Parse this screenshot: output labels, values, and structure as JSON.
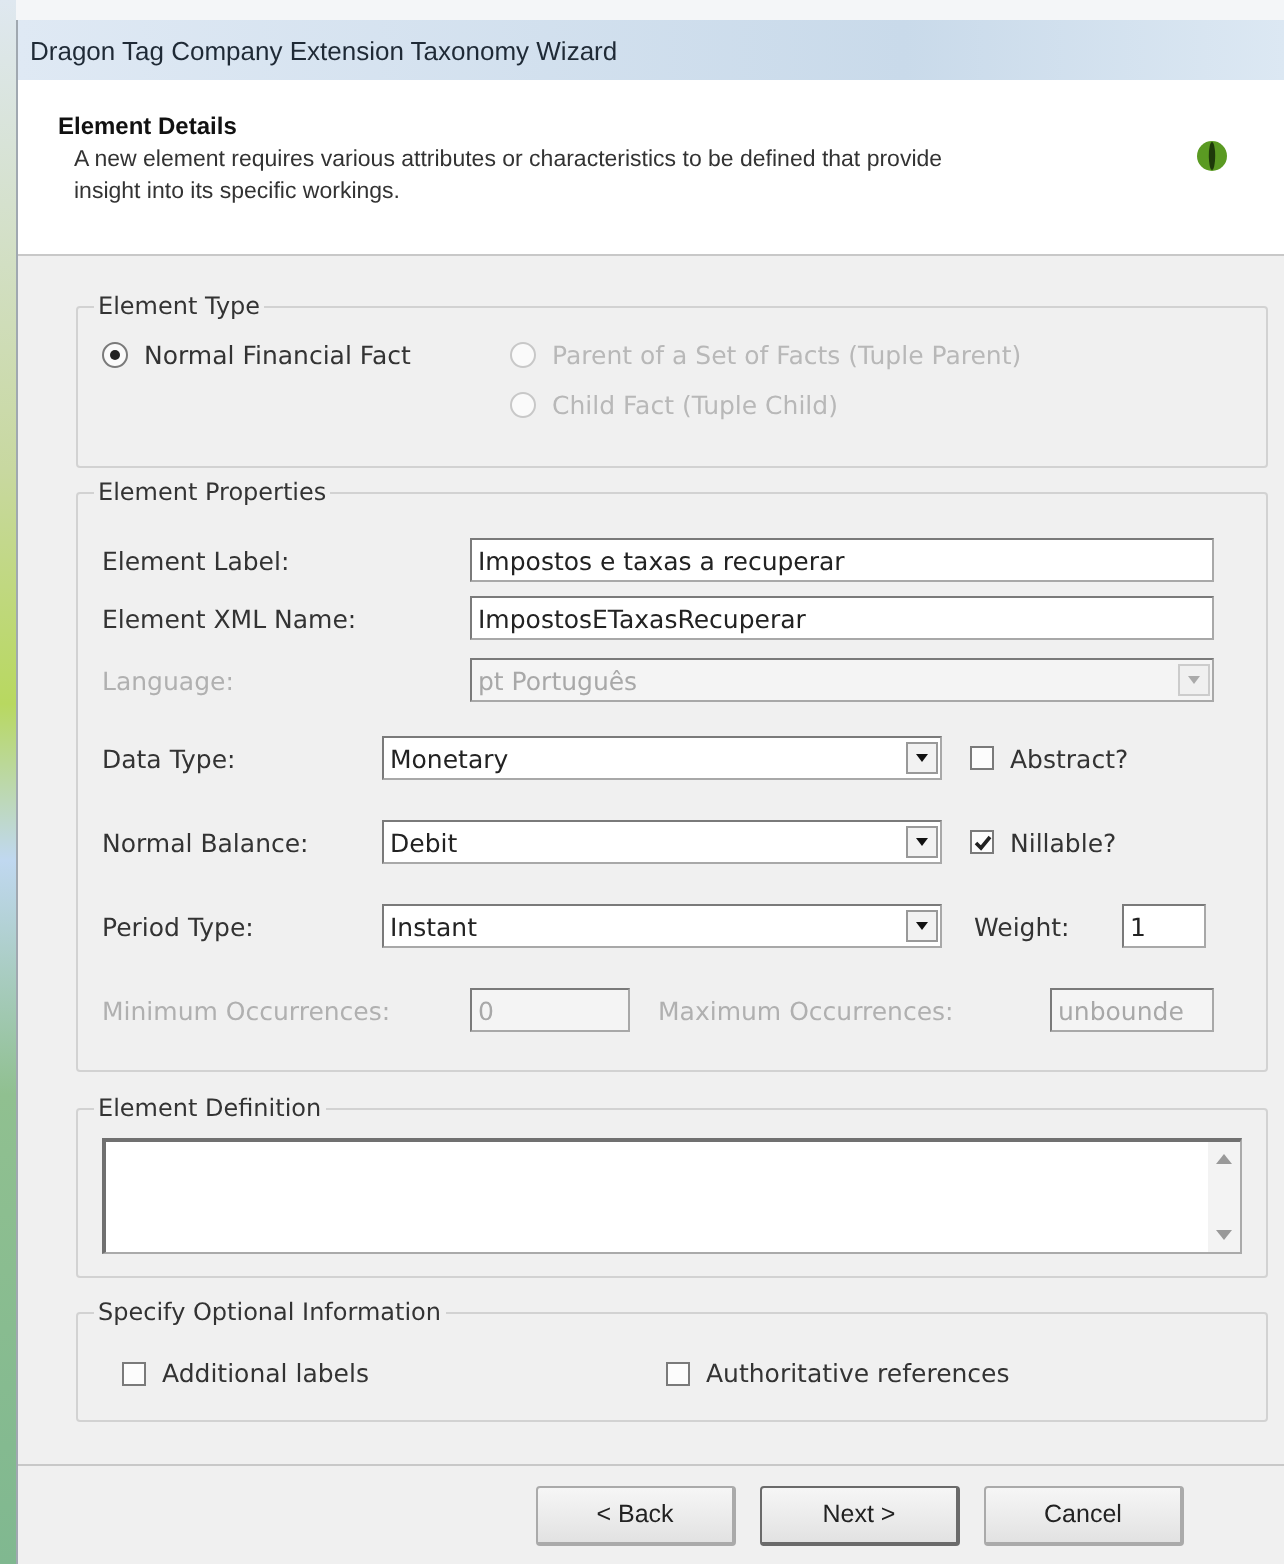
{
  "window": {
    "title": "Dragon Tag Company Extension Taxonomy Wizard"
  },
  "header": {
    "title": "Element Details",
    "description": "A new element requires various attributes or characteristics to be defined that provide insight into its specific workings."
  },
  "element_type": {
    "legend": "Element Type",
    "options": [
      {
        "label": "Normal Financial Fact",
        "selected": true,
        "disabled": false
      },
      {
        "label": "Parent of a Set of Facts (Tuple Parent)",
        "selected": false,
        "disabled": true
      },
      {
        "label": "Child Fact (Tuple Child)",
        "selected": false,
        "disabled": true
      }
    ]
  },
  "element_properties": {
    "legend": "Element Properties",
    "element_label": {
      "label": "Element Label:",
      "value": "Impostos e taxas a recuperar"
    },
    "xml_name": {
      "label": "Element XML Name:",
      "value": "ImpostosETaxasRecuperar"
    },
    "language": {
      "label": "Language:",
      "value": "pt Português",
      "disabled": true
    },
    "data_type": {
      "label": "Data Type:",
      "value": "Monetary",
      "disabled": false
    },
    "abstract": {
      "label": "Abstract?",
      "checked": false
    },
    "normal_balance": {
      "label": "Normal Balance:",
      "value": "Debit",
      "disabled": false
    },
    "nillable": {
      "label": "Nillable?",
      "checked": true
    },
    "period_type": {
      "label": "Period Type:",
      "value": "Instant",
      "disabled": false
    },
    "weight": {
      "label": "Weight:",
      "value": "1"
    },
    "min_occurrences": {
      "label": "Minimum Occurrences:",
      "value": "0",
      "disabled": true
    },
    "max_occurrences": {
      "label": "Maximum Occurrences:",
      "value": "unbounde",
      "disabled": true
    }
  },
  "element_definition": {
    "legend": "Element Definition"
  },
  "optional_information": {
    "legend": "Specify Optional Information",
    "options": [
      {
        "label": "Additional labels",
        "checked": false
      },
      {
        "label": "Authoritative references",
        "checked": false
      }
    ]
  },
  "buttons": [
    {
      "label": "< Back",
      "default": false
    },
    {
      "label": "Next >",
      "default": true
    },
    {
      "label": "Cancel",
      "default": false
    }
  ]
}
